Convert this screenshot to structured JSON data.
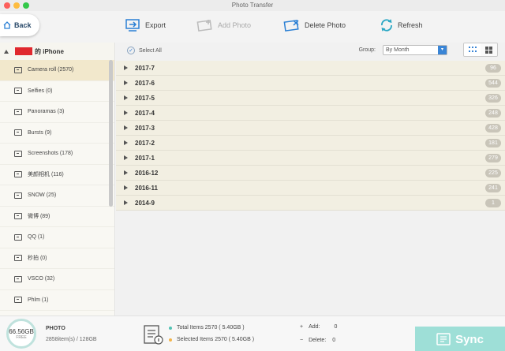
{
  "window": {
    "title": "Photo Transfer"
  },
  "back": {
    "label": "Back"
  },
  "toolbar": {
    "export": "Export",
    "add_photo": "Add Photo",
    "delete_photo": "Delete Photo",
    "refresh": "Refresh"
  },
  "device": {
    "name_suffix": "的 iPhone"
  },
  "sidebar": {
    "items": [
      {
        "label": "Camera roll (2570)",
        "icon": "camera-icon"
      },
      {
        "label": "Selfies (0)",
        "icon": "selfie-icon"
      },
      {
        "label": "Panoramas (3)",
        "icon": "panorama-icon"
      },
      {
        "label": "Bursts (9)",
        "icon": "burst-icon"
      },
      {
        "label": "Screenshots (178)",
        "icon": "screenshot-icon"
      },
      {
        "label": "美颜相机 (116)",
        "icon": "album-icon"
      },
      {
        "label": "SNOW (25)",
        "icon": "album-icon"
      },
      {
        "label": "微博 (89)",
        "icon": "album-icon"
      },
      {
        "label": "QQ (1)",
        "icon": "album-icon"
      },
      {
        "label": "秒拍 (0)",
        "icon": "album-icon"
      },
      {
        "label": "VSCO (32)",
        "icon": "album-icon"
      },
      {
        "label": "Phlm (1)",
        "icon": "album-icon"
      }
    ]
  },
  "main": {
    "select_all": "Select All",
    "group_label": "Group:",
    "group_value": "By Month",
    "groups": [
      {
        "month": "2017-7",
        "count": "96"
      },
      {
        "month": "2017-6",
        "count": "544"
      },
      {
        "month": "2017-5",
        "count": "326"
      },
      {
        "month": "2017-4",
        "count": "248"
      },
      {
        "month": "2017-3",
        "count": "428"
      },
      {
        "month": "2017-2",
        "count": "181"
      },
      {
        "month": "2017-1",
        "count": "279"
      },
      {
        "month": "2016-12",
        "count": "225"
      },
      {
        "month": "2016-11",
        "count": "241"
      },
      {
        "month": "2014-9",
        "count": "1"
      }
    ]
  },
  "footer": {
    "free_size": "66.56GB",
    "free_label": "FREE",
    "type": "PHOTO",
    "count_line": "2858item(s) / 128GB",
    "total_items": "Total Items 2570 ( 5.40GB )",
    "selected_items": "Selected Items 2570 ( 5.40GB )",
    "add_label": "Add:",
    "add_value": "0",
    "delete_label": "Delete:",
    "delete_value": "0",
    "sync_label": "Sync"
  },
  "colors": {
    "accent": "#3a85d6",
    "sync": "#9edfd7",
    "selected_row": "#f2e8cc"
  }
}
